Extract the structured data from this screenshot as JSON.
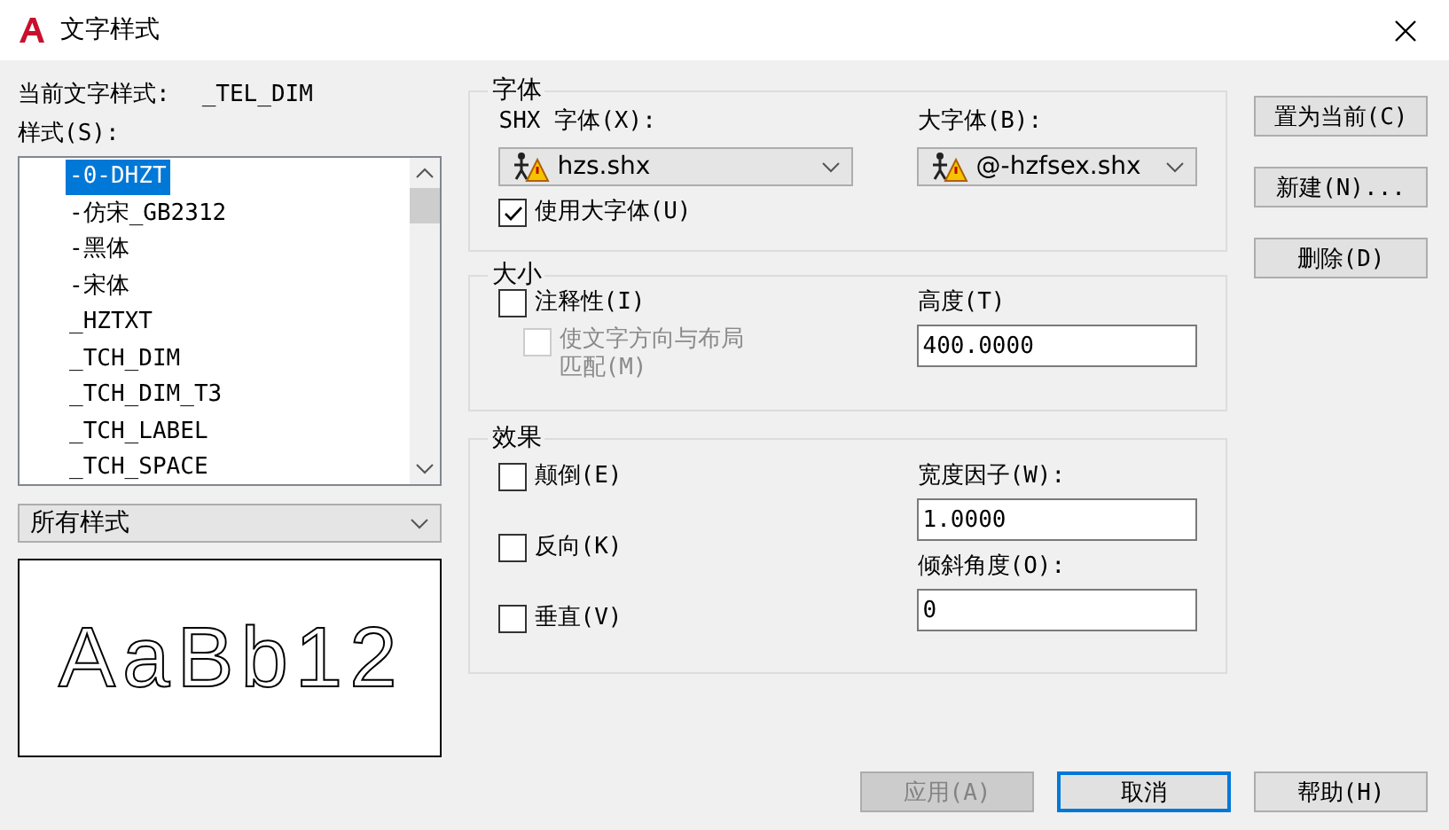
{
  "window": {
    "title": "文字样式"
  },
  "current_style": {
    "label": "当前文字样式:",
    "value": "_TEL_DIM"
  },
  "styles": {
    "label": "样式(S):",
    "items": [
      {
        "label": "-0-DHZT",
        "selected": true
      },
      {
        "label": "-仿宋_GB2312",
        "selected": false
      },
      {
        "label": "-黑体",
        "selected": false
      },
      {
        "label": "-宋体",
        "selected": false
      },
      {
        "label": "_HZTXT",
        "selected": false
      },
      {
        "label": "_TCH_DIM",
        "selected": false
      },
      {
        "label": "_TCH_DIM_T3",
        "selected": false
      },
      {
        "label": "_TCH_LABEL",
        "selected": false
      },
      {
        "label": "_TCH_SPACE",
        "selected": false
      }
    ]
  },
  "filter": {
    "value": "所有样式"
  },
  "preview": {
    "text": "AaBb12"
  },
  "font_group": {
    "title": "字体",
    "shx_font": {
      "label": "SHX 字体(X):",
      "value": "hzs.shx"
    },
    "big_font": {
      "label": "大字体(B):",
      "value": "@-hzfsex.shx"
    },
    "use_big_font": {
      "label": "使用大字体(U)",
      "checked": true
    }
  },
  "size_group": {
    "title": "大小",
    "annotative": {
      "label": "注释性(I)",
      "checked": false,
      "disabled": false
    },
    "match_orientation": {
      "label": "使文字方向与布局匹配(M)",
      "checked": false,
      "disabled": true
    },
    "height": {
      "label": "高度(T)",
      "value": "400.0000"
    }
  },
  "effects_group": {
    "title": "效果",
    "options": [
      {
        "label": "颠倒(E)",
        "checked": false
      },
      {
        "label": "反向(K)",
        "checked": false
      },
      {
        "label": "垂直(V)",
        "checked": false
      }
    ],
    "width_factor": {
      "label": "宽度因子(W):",
      "value": "1.0000"
    },
    "oblique_angle": {
      "label": "倾斜角度(O):",
      "value": "0"
    }
  },
  "side_buttons": [
    {
      "label": "置为当前(C)",
      "disabled": false
    },
    {
      "label": "新建(N)...",
      "disabled": false
    },
    {
      "label": "删除(D)",
      "disabled": false
    }
  ],
  "footer_buttons": [
    {
      "label": "应用(A)",
      "disabled": true,
      "focused": false
    },
    {
      "label": "取消",
      "disabled": false,
      "focused": true
    },
    {
      "label": "帮助(H)",
      "disabled": false,
      "focused": false
    }
  ]
}
